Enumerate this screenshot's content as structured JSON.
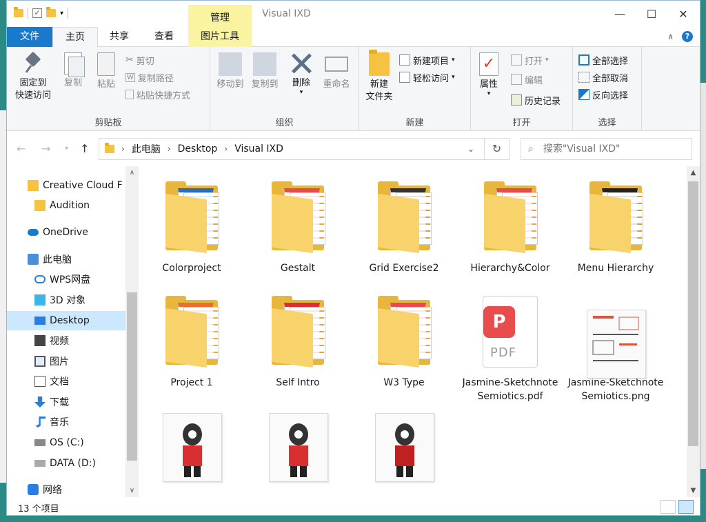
{
  "window": {
    "title": "Visual IXD",
    "context_tab": "管理",
    "controls": {
      "minimize": "—",
      "maximize": "☐",
      "close": "✕"
    }
  },
  "ribbon_tabs": [
    {
      "label": "文件"
    },
    {
      "label": "主页"
    },
    {
      "label": "共享"
    },
    {
      "label": "查看"
    },
    {
      "label": "图片工具"
    }
  ],
  "ribbon": {
    "clipboard": {
      "label": "剪贴板",
      "pin_line1": "固定到",
      "pin_line2": "快速访问",
      "copy": "复制",
      "paste": "粘贴",
      "cut": "剪切",
      "copy_path": "复制路径",
      "paste_shortcut": "粘贴快捷方式"
    },
    "organize": {
      "label": "组织",
      "move_to": "移动到",
      "copy_to": "复制到",
      "delete": "删除",
      "rename": "重命名"
    },
    "new": {
      "label": "新建",
      "new_folder_line1": "新建",
      "new_folder_line2": "文件夹",
      "new_item": "新建项目",
      "easy_access": "轻松访问"
    },
    "open": {
      "label": "打开",
      "properties": "属性",
      "open": "打开",
      "edit": "编辑",
      "history": "历史记录"
    },
    "select": {
      "label": "选择",
      "select_all": "全部选择",
      "select_none": "全部取消",
      "invert": "反向选择"
    }
  },
  "address": {
    "breadcrumb": [
      "此电脑",
      "Desktop",
      "Visual IXD"
    ],
    "search_placeholder": "搜索\"Visual IXD\""
  },
  "nav_pane": [
    {
      "label": "Creative Cloud F",
      "icon": "creative-cloud-icon",
      "indent": 1
    },
    {
      "label": "Audition",
      "icon": "audition-folder-icon",
      "indent": 2
    },
    {
      "label": "OneDrive",
      "icon": "onedrive-icon",
      "indent": 1
    },
    {
      "label": "此电脑",
      "icon": "computer-icon",
      "indent": 1
    },
    {
      "label": "WPS网盘",
      "icon": "cloud-icon",
      "indent": 2
    },
    {
      "label": "3D 对象",
      "icon": "3d-objects-icon",
      "indent": 2
    },
    {
      "label": "Desktop",
      "icon": "desktop-icon",
      "indent": 2,
      "selected": true
    },
    {
      "label": "视频",
      "icon": "video-icon",
      "indent": 2
    },
    {
      "label": "图片",
      "icon": "pictures-icon",
      "indent": 2
    },
    {
      "label": "文档",
      "icon": "documents-icon",
      "indent": 2
    },
    {
      "label": "下载",
      "icon": "download-icon",
      "indent": 2
    },
    {
      "label": "音乐",
      "icon": "music-icon",
      "indent": 2
    },
    {
      "label": "OS (C:)",
      "icon": "drive-c-icon",
      "indent": 2
    },
    {
      "label": "DATA (D:)",
      "icon": "drive-d-icon",
      "indent": 2
    },
    {
      "label": "网络",
      "icon": "network-icon",
      "indent": 1
    }
  ],
  "files": [
    {
      "name": "Colorproject",
      "type": "folder",
      "accent": "#2a6fbf"
    },
    {
      "name": "Gestalt",
      "type": "folder",
      "accent": "#e84c4c"
    },
    {
      "name": "Grid Exercise2",
      "type": "folder",
      "accent": "#333333"
    },
    {
      "name": "Hierarchy&Color",
      "type": "folder",
      "accent": "#e84c4c"
    },
    {
      "name": "Menu Hierarchy",
      "type": "folder",
      "accent": "#222222"
    },
    {
      "name": "Project 1",
      "type": "folder",
      "accent": "#e8702a"
    },
    {
      "name": "Self Intro",
      "type": "folder",
      "accent": "#d83030"
    },
    {
      "name": "W3 Type",
      "type": "folder",
      "accent": "#e84c4c"
    },
    {
      "name": "Jasmine-Sketchnote Semiotics.pdf",
      "type": "pdf",
      "accent": "#e84c4c"
    },
    {
      "name": "Jasmine-Sketchnote Semiotics.png",
      "type": "image",
      "accent": "#d85a3a"
    },
    {
      "name": "",
      "type": "image",
      "accent": "#d83030"
    },
    {
      "name": "",
      "type": "image",
      "accent": "#d83030"
    },
    {
      "name": "",
      "type": "image",
      "accent": "#c02020"
    }
  ],
  "status": {
    "count": "13 个项目"
  },
  "colors": {
    "file_tab": "#1979ca",
    "selection": "#cce8ff",
    "context_tab": "#faf3a0",
    "folder": "#f5c242"
  }
}
